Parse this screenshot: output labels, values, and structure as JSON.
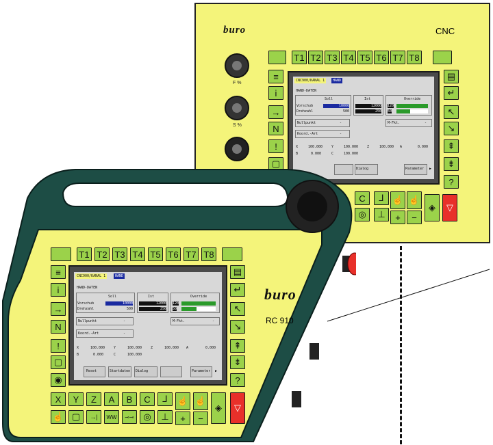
{
  "cnc_panel": {
    "logo": "buro",
    "label": "CNC",
    "tool_keys": [
      "",
      "T1",
      "T2",
      "T3",
      "T4",
      "T5",
      "T6",
      "T7",
      "T8",
      ""
    ],
    "knobs": [
      {
        "label": "F %"
      },
      {
        "label": "S %"
      },
      {
        "label": ""
      }
    ]
  },
  "rc_panel": {
    "logo": "buro",
    "model": "RC 910",
    "tool_keys": [
      "",
      "T1",
      "T2",
      "T3",
      "T4",
      "T5",
      "T6",
      "T7",
      "T8",
      ""
    ],
    "bottom_row1": [
      "X",
      "Y",
      "Z",
      "A",
      "B",
      "C",
      "⅃",
      "☝",
      "☝",
      "◈",
      "▽"
    ],
    "bottom_row2": [
      "☝",
      "▢",
      "→|",
      "WW",
      "⊸⊸",
      "◎",
      "⊥",
      "+",
      "−"
    ]
  },
  "screen": {
    "header_left": "CNC900/KANAL 1",
    "header_right": "HAND",
    "title": "HAND-DATEN",
    "col_soll": "Soll",
    "col_ist": "Ist",
    "col_override": "Override",
    "row1_label": "Vorschub",
    "row1_soll": "10000",
    "row1_ist": "12000",
    "row1_ovr": "120",
    "row2_label": "Drehzahl",
    "row2_soll": "500",
    "row2_ist": "250",
    "row2_ovr": "50",
    "nullpunkt": "Nullpunkt",
    "mfkt": "M-Fkt.",
    "koord": "Koord.-Art",
    "dash": "-",
    "axis_x": "X",
    "axis_y": "Y",
    "axis_z": "Z",
    "axis_a": "A",
    "axis_b": "B",
    "axis_c": "C",
    "v_x": "100.000",
    "v_y": "100.000",
    "v_z": "100.000",
    "v_a": "0.000",
    "v_b": "0.000",
    "v_c": "100.000",
    "soft1": "Reset",
    "soft2": "Startdaten",
    "soft3": "Dialog",
    "soft4": "",
    "soft5": "",
    "soft6": "Parameter",
    "arrow": "▶"
  },
  "colors": {
    "panel": "#f4f47a",
    "key": "#9bd24a",
    "red": "#e8302a",
    "body": "#1d4d45"
  }
}
